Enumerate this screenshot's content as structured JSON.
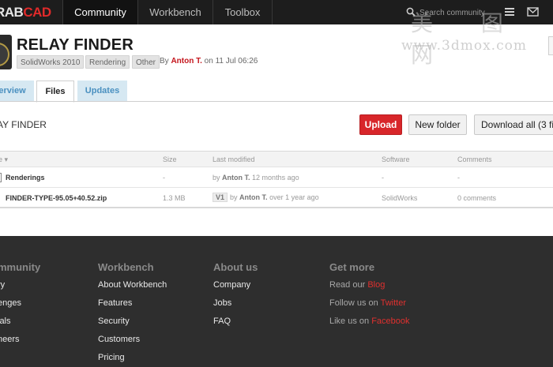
{
  "nav": {
    "logo_left": "RAB",
    "logo_right": "CAD",
    "tabs": [
      {
        "label": "Community"
      },
      {
        "label": "Workbench"
      },
      {
        "label": "Toolbox"
      }
    ],
    "search_placeholder": "Search community",
    "icons": [
      "search-icon",
      "menu-icon",
      "mail-icon"
    ]
  },
  "watermark": {
    "chinese": "美 图 网",
    "url": "www.3dmox.com"
  },
  "model": {
    "title": "RELAY FINDER",
    "tags": [
      "SolidWorks 2010",
      "Rendering",
      "Other"
    ],
    "by_label": "By",
    "author": "Anton T.",
    "date_text": "on 11 Jul 06:26"
  },
  "tabs": [
    {
      "label": "erview"
    },
    {
      "label": "Files"
    },
    {
      "label": "Updates"
    }
  ],
  "files_panel": {
    "folder_name": "AY FINDER",
    "buttons": {
      "upload": "Upload",
      "new_folder": "New folder",
      "download_all": "Download all (3 fil"
    },
    "columns": {
      "name": "e ▾",
      "size": "Size",
      "modified": "Last modified",
      "software": "Software",
      "comments": "Comments"
    },
    "rows": [
      {
        "name": "Renderings",
        "size": "-",
        "version": "",
        "by": "by",
        "author": "Anton T.",
        "when": "12 months ago",
        "software": "-",
        "comments": "-"
      },
      {
        "name": "FINDER-TYPE-95.05+40.52.zip",
        "size": "1.3 MB",
        "version": "V1",
        "by": "by",
        "author": "Anton T.",
        "when": "over 1 year ago",
        "software": "SolidWorks",
        "comments": "0 comments"
      }
    ]
  },
  "footer": {
    "community": {
      "heading": "mmunity",
      "links": [
        "ry",
        "enges",
        "ials",
        "neers"
      ]
    },
    "workbench": {
      "heading": "Workbench",
      "links": [
        "About Workbench",
        "Features",
        "Security",
        "Customers",
        "Pricing"
      ]
    },
    "about": {
      "heading": "About us",
      "links": [
        "Company",
        "Jobs",
        "FAQ"
      ]
    },
    "getmore": {
      "heading": "Get more",
      "lines": [
        {
          "prefix": "Read our ",
          "link": "Blog"
        },
        {
          "prefix": "Follow us on ",
          "link": "Twitter"
        },
        {
          "prefix": "Like us on ",
          "link": "Facebook"
        }
      ]
    }
  },
  "colors": {
    "brand_red": "#d8262a",
    "nav_bg": "#1d1d1d",
    "footer_bg": "#2e2e2e",
    "tab_blue": "#4a90c0"
  }
}
